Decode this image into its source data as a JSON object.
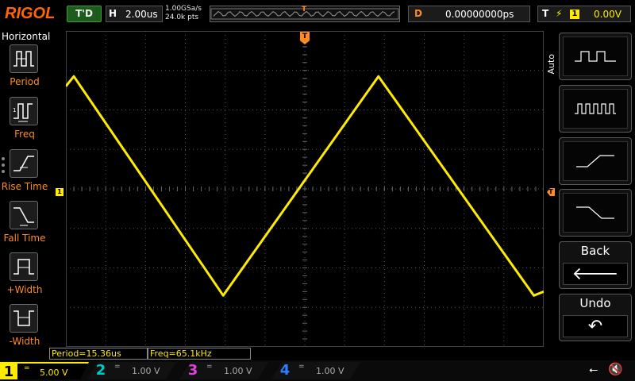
{
  "brand": "RIGOL",
  "run_status": "T'D",
  "timebase": {
    "letter": "H",
    "value": "2.00us"
  },
  "acquisition": {
    "sample_rate": "1.00GSa/s",
    "points": "24.0k pts"
  },
  "delay": {
    "letter": "D",
    "value": "0.00000000ps"
  },
  "trigger": {
    "letter": "T",
    "edge_symbol": "⚡",
    "source": "1",
    "level": "0.00V"
  },
  "markers": {
    "trigger_time": "T",
    "trigger_level": "T",
    "ch1_ground": "1"
  },
  "left_menu": {
    "title": "Horizontal",
    "items": [
      {
        "label": "Period",
        "icon": "period-icon"
      },
      {
        "label": "Freq",
        "icon": "freq-icon"
      },
      {
        "label": "Rise Time",
        "icon": "rise-time-icon"
      },
      {
        "label": "Fall Time",
        "icon": "fall-time-icon"
      },
      {
        "label": "+Width",
        "icon": "positive-width-icon"
      },
      {
        "label": "-Width",
        "icon": "negative-width-icon"
      }
    ]
  },
  "right_menu": {
    "title": "Auto",
    "buttons": [
      {
        "icon": "square-wave-few-icon"
      },
      {
        "icon": "square-wave-many-icon"
      },
      {
        "icon": "rising-edge-icon"
      },
      {
        "icon": "falling-edge-icon"
      },
      {
        "label": "Back",
        "icon": "back-arrow-icon",
        "glyph": "🡐"
      },
      {
        "label": "Undo",
        "icon": "undo-icon",
        "glyph": "↶"
      }
    ]
  },
  "measurements": {
    "period": "Period=15.36us",
    "freq": "Freq=65.1kHz"
  },
  "channels": [
    {
      "num": "1",
      "coupling": "=",
      "scale": "5.00 V",
      "color": "#ffeb00",
      "active": true
    },
    {
      "num": "2",
      "coupling": "=",
      "scale": "1.00 V",
      "color": "#00c9c9",
      "active": false
    },
    {
      "num": "3",
      "coupling": "=",
      "scale": "1.00 V",
      "color": "#e040e0",
      "active": false
    },
    {
      "num": "4",
      "coupling": "=",
      "scale": "1.00 V",
      "color": "#2e7dff",
      "active": false
    }
  ],
  "colors": {
    "ch1": "#ffeb00",
    "trigger": "#ff8a1f",
    "accent": "#ff6600"
  },
  "chart_data": {
    "type": "line",
    "x_divisions": 12,
    "y_divisions": 8,
    "series": [
      {
        "values": [
          {
            "x_div": 0.0,
            "y_div": 2.6
          },
          {
            "x_div": 0.2,
            "y_div": 2.85
          },
          {
            "x_div": 3.95,
            "y_div": -2.7
          },
          {
            "x_div": 7.85,
            "y_div": 2.85
          },
          {
            "x_div": 11.75,
            "y_div": -2.7
          },
          {
            "x_div": 12.0,
            "y_div": -2.6
          }
        ]
      }
    ]
  }
}
